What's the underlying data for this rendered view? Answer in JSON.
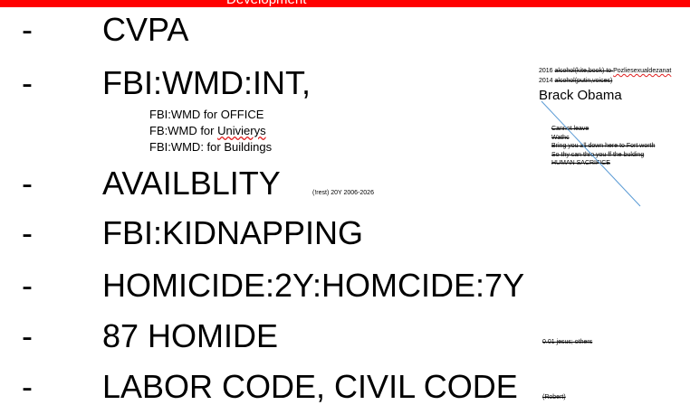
{
  "header": {
    "title": "Development",
    "color": "#ff0000"
  },
  "bullets": [
    {
      "marker": "-",
      "text": "CVPA"
    },
    {
      "marker": "-",
      "text": "FBI:WMD:INT,"
    },
    {
      "marker": "-",
      "text": "AVAILBLITY"
    },
    {
      "marker": "-",
      "text": "FBI:KIDNAPPING"
    },
    {
      "marker": "-",
      "text": "HOMICIDE:2Y:HOMCIDE:7Y"
    },
    {
      "marker": "-",
      "text": "87 HOMIDE"
    },
    {
      "marker": "-",
      "text": "LABOR CODE, CIVIL CODE"
    }
  ],
  "subitems": [
    "FBI:WMD for OFFICE",
    "FB:WMD for ",
    "Univierys",
    "FBI:WMD: for Buildings"
  ],
  "notes": {
    "availability": "(!rest) 20Y 2006-2026",
    "line1_year": "2016 ",
    "line1_struck": "alcohol(kite,book) to ",
    "line1_rest": "Pozliesexualdezanat",
    "line2_year": "2014 ",
    "line2_struck": "alcohol(putin,voices)",
    "name": "Brack Obama",
    "struck": [
      "Cannot leave",
      "Wathc",
      "Bring you all down here to Fort worth",
      "So thy can thro you ff the bulding",
      "HUMAN SACRIFICE"
    ],
    "others": "0.01 jesus; others",
    "robert": "(Robert)"
  }
}
